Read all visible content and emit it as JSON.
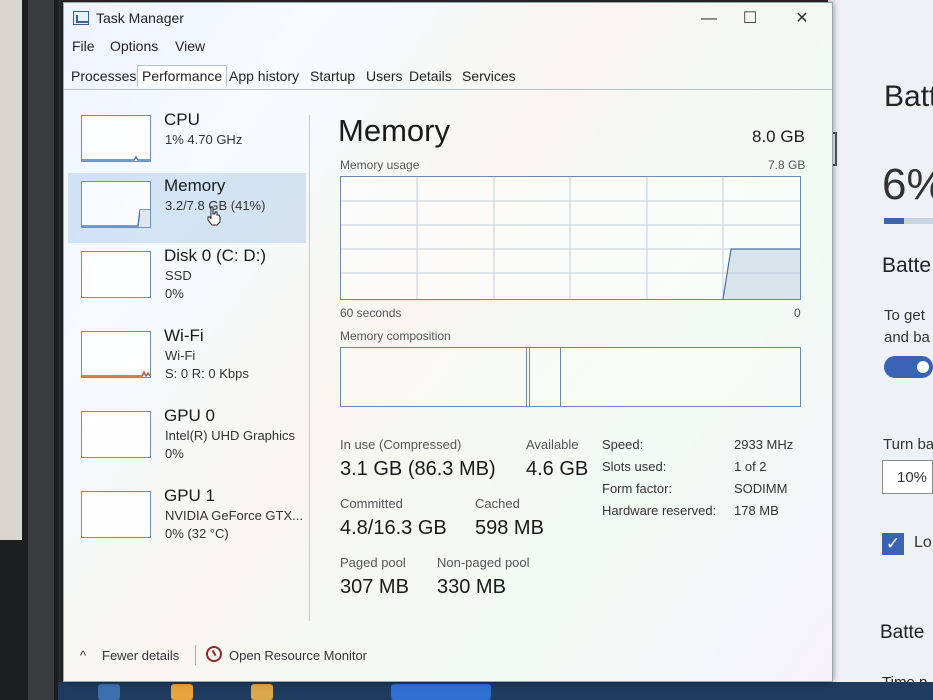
{
  "window": {
    "title": "Task Manager",
    "controls": {
      "minimize": "—",
      "maximize": "☐",
      "close": "✕"
    }
  },
  "menu": [
    "File",
    "Options",
    "View"
  ],
  "tabs": [
    "Processes",
    "Performance",
    "App history",
    "Startup",
    "Users",
    "Details",
    "Services"
  ],
  "active_tab": "Performance",
  "sidebar": [
    {
      "name": "CPU",
      "line1": "1% 4.70 GHz",
      "line2": ""
    },
    {
      "name": "Memory",
      "line1": "3.2/7.8 GB (41%)",
      "line2": "",
      "selected": true
    },
    {
      "name": "Disk 0 (C: D:)",
      "line1": "SSD",
      "line2": "0%"
    },
    {
      "name": "Wi-Fi",
      "line1": "Wi-Fi",
      "line2": "S: 0 R: 0 Kbps"
    },
    {
      "name": "GPU 0",
      "line1": "Intel(R) UHD Graphics",
      "line2": "0%"
    },
    {
      "name": "GPU 1",
      "line1": "NVIDIA GeForce GTX...",
      "line2": "0% (32 °C)"
    }
  ],
  "panel": {
    "title": "Memory",
    "total": "8.0 GB",
    "usage_label": "Memory usage",
    "usage_max": "7.8 GB",
    "axis_left": "60 seconds",
    "axis_right": "0",
    "composition_label": "Memory composition"
  },
  "stats": {
    "in_use_label": "In use (Compressed)",
    "in_use_value": "3.1 GB (86.3 MB)",
    "available_label": "Available",
    "available_value": "4.6 GB",
    "committed_label": "Committed",
    "committed_value": "4.8/16.3 GB",
    "cached_label": "Cached",
    "cached_value": "598 MB",
    "paged_label": "Paged pool",
    "paged_value": "307 MB",
    "nonpaged_label": "Non-paged pool",
    "nonpaged_value": "330 MB"
  },
  "specs": [
    {
      "label": "Speed:",
      "value": "2933 MHz"
    },
    {
      "label": "Slots used:",
      "value": "1 of 2"
    },
    {
      "label": "Form factor:",
      "value": "SODIMM"
    },
    {
      "label": "Hardware reserved:",
      "value": "178 MB"
    }
  ],
  "footer": {
    "fewer_details": "Fewer details",
    "open_resource_monitor": "Open Resource Monitor"
  },
  "background_app": {
    "title": "Batt",
    "percent": "6%",
    "section1": "Batte",
    "paragraph": [
      "To get",
      "and ba"
    ],
    "turn_label": "Turn ba",
    "select_value": "10%",
    "checkbox_label": "Lo",
    "section2": "Batte",
    "time_label": "Time p"
  },
  "colors": {
    "accent": "#3b63b5",
    "graph_border": "#6d87a8",
    "selected_bg": "#aac8e8"
  }
}
